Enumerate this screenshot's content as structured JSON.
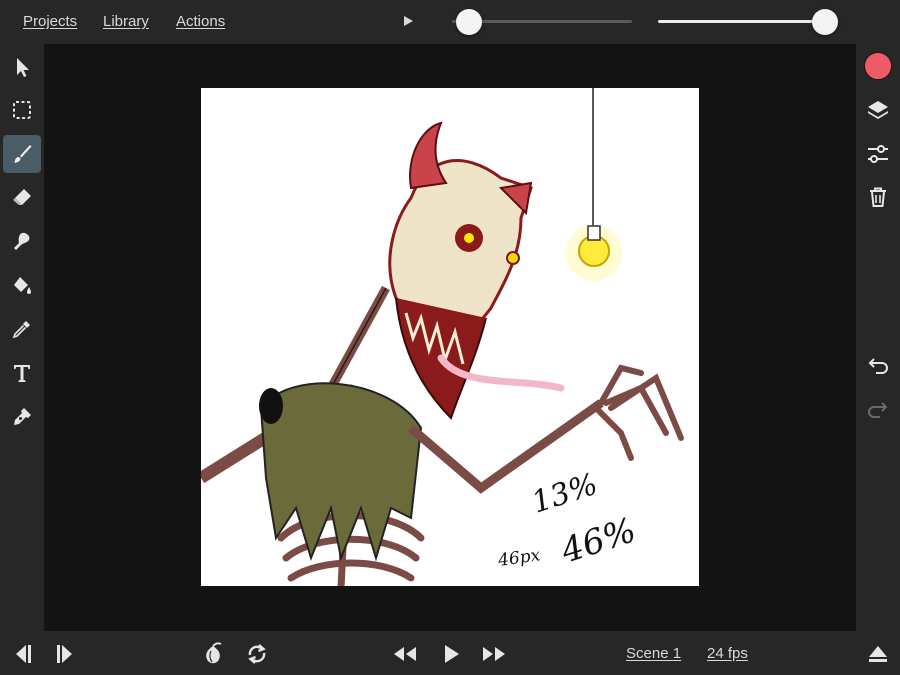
{
  "menu": {
    "projects": "Projects",
    "library": "Library",
    "actions": "Actions"
  },
  "playback": {
    "frame_position": 0.02,
    "onion_opacity": 1.0
  },
  "tools": {
    "items": [
      "select-icon",
      "marquee-icon",
      "brush-icon",
      "eraser-icon",
      "smudge-icon",
      "fill-icon",
      "eyedropper-icon",
      "text-icon",
      "pen-icon"
    ],
    "active": "brush-icon"
  },
  "right": {
    "current_color": "#f05a64"
  },
  "canvas": {
    "handwriting": {
      "a": "13%",
      "b": "46%",
      "c": "46px"
    }
  },
  "bottom": {
    "scene": "Scene 1",
    "fps": "24 fps"
  },
  "colors": {
    "bar": "#272727",
    "workspace": "#131313",
    "active_tool": "#4a5c66",
    "accent": "#f05a64"
  }
}
